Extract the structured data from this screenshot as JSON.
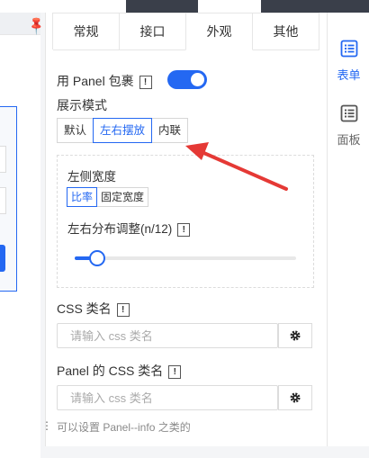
{
  "tabs": [
    "常规",
    "接口",
    "外观",
    "其他"
  ],
  "active_tab": "外观",
  "wrap_panel": {
    "label": "用 Panel 包裹",
    "enabled": true
  },
  "display_mode": {
    "label": "展示模式",
    "options": [
      "默认",
      "左右摆放",
      "内联"
    ],
    "selected": "左右摆放"
  },
  "left_width": {
    "label": "左侧宽度",
    "options": [
      "比率",
      "固定宽度"
    ],
    "selected": "比率"
  },
  "distribution": {
    "label": "左右分布调整(n/12)",
    "value": 1,
    "max": 12
  },
  "css_class": {
    "label": "CSS 类名",
    "placeholder": "请输入 css 类名"
  },
  "panel_css_class": {
    "label": "Panel 的 CSS 类名",
    "placeholder": "请输入 css 类名"
  },
  "hint": "可以设置 Panel--info 之类的",
  "rail": [
    {
      "label": "表单",
      "icon": "list-icon",
      "active": true
    },
    {
      "label": "面板",
      "icon": "panel-icon",
      "active": false
    }
  ],
  "colors": {
    "accent": "#2468f2",
    "annotation_arrow": "#e53935"
  }
}
